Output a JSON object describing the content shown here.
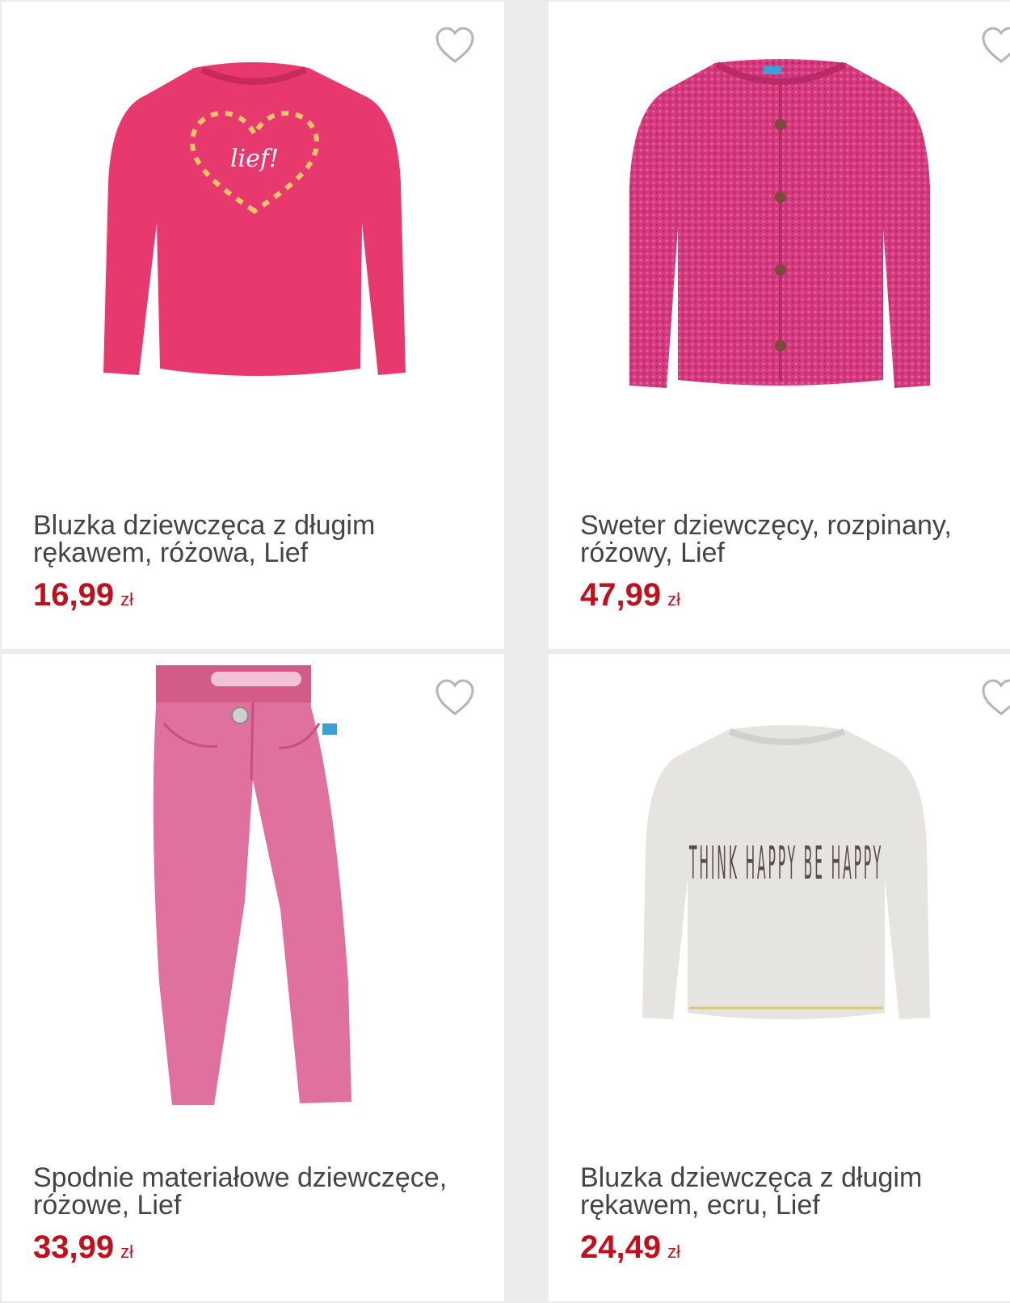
{
  "colors": {
    "price": "#c0101e",
    "title": "#444444",
    "background": "#ececec",
    "card": "#ffffff",
    "heart": "#b5b5b5"
  },
  "products": [
    {
      "title": "Bluzka dziewczęca z długim rękawem, różowa, Lief",
      "price": "16,99",
      "currency": "zł",
      "image": "pink-long-sleeve-top-heart-print",
      "image_print": "lief!",
      "favorite_icon": "heart-outline-icon"
    },
    {
      "title": "Sweter dziewczęcy, rozpinany, różowy, Lief",
      "price": "47,99",
      "currency": "zł",
      "image": "pink-knit-cardigan",
      "favorite_icon": "heart-outline-icon"
    },
    {
      "title": "Spodnie materiałowe dziewczęce, różowe, Lief",
      "price": "33,99",
      "currency": "zł",
      "image": "pink-trousers",
      "favorite_icon": "heart-outline-icon"
    },
    {
      "title": "Bluzka dziewczęca z długim rękawem, ecru, Lief",
      "price": "24,49",
      "currency": "zł",
      "image": "ecru-long-sleeve-top-think-happy-print",
      "image_print": "THINK HAPPY BE HAPPY",
      "favorite_icon": "heart-outline-icon"
    }
  ]
}
